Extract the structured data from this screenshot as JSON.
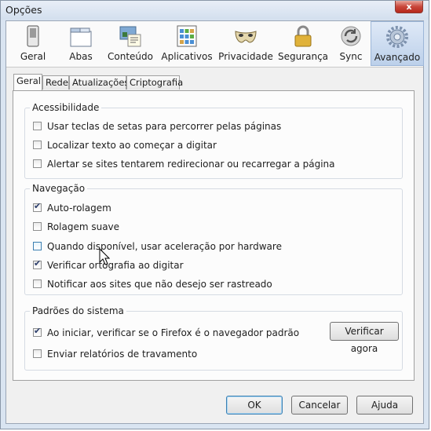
{
  "window": {
    "title": "Opções",
    "close_label": "x"
  },
  "toolbar": {
    "items": [
      {
        "label": "Geral",
        "icon": "switch-icon"
      },
      {
        "label": "Abas",
        "icon": "tabs-icon"
      },
      {
        "label": "Conteúdo",
        "icon": "content-icon"
      },
      {
        "label": "Aplicativos",
        "icon": "applications-icon"
      },
      {
        "label": "Privacidade",
        "icon": "mask-icon"
      },
      {
        "label": "Segurança",
        "icon": "padlock-icon"
      },
      {
        "label": "Sync",
        "icon": "sync-icon"
      },
      {
        "label": "Avançado",
        "icon": "gear-icon"
      }
    ],
    "active": "Avançado"
  },
  "tabs": {
    "items": [
      "Geral",
      "Rede",
      "Atualizações",
      "Criptografia"
    ],
    "active": "Geral"
  },
  "groups": {
    "accessibility": {
      "title": "Acessibilidade",
      "options": [
        {
          "label": "Usar teclas de setas para percorrer pelas páginas",
          "checked": false
        },
        {
          "label": "Localizar texto ao começar a digitar",
          "checked": false
        },
        {
          "label": "Alertar se sites tentarem redirecionar ou recarregar a página",
          "checked": false
        }
      ]
    },
    "navigation": {
      "title": "Navegação",
      "options": [
        {
          "label": "Auto-rolagem",
          "checked": true
        },
        {
          "label": "Rolagem suave",
          "checked": false
        },
        {
          "label": "Quando disponível, usar aceleração por hardware",
          "checked": false,
          "highlighted": true
        },
        {
          "label": "Verificar ortografia ao digitar",
          "checked": true
        },
        {
          "label": "Notificar aos sites que não desejo ser rastreado",
          "checked": false
        }
      ]
    },
    "system": {
      "title": "Padrões do sistema",
      "options": [
        {
          "label": "Ao iniciar, verificar se o Firefox é o navegador padrão",
          "checked": true
        },
        {
          "label": "Enviar relatórios de travamento",
          "checked": false
        }
      ],
      "check_now_label": "Verificar agora"
    }
  },
  "footer": {
    "ok_label": "OK",
    "cancel_label": "Cancelar",
    "help_label": "Ajuda"
  }
}
